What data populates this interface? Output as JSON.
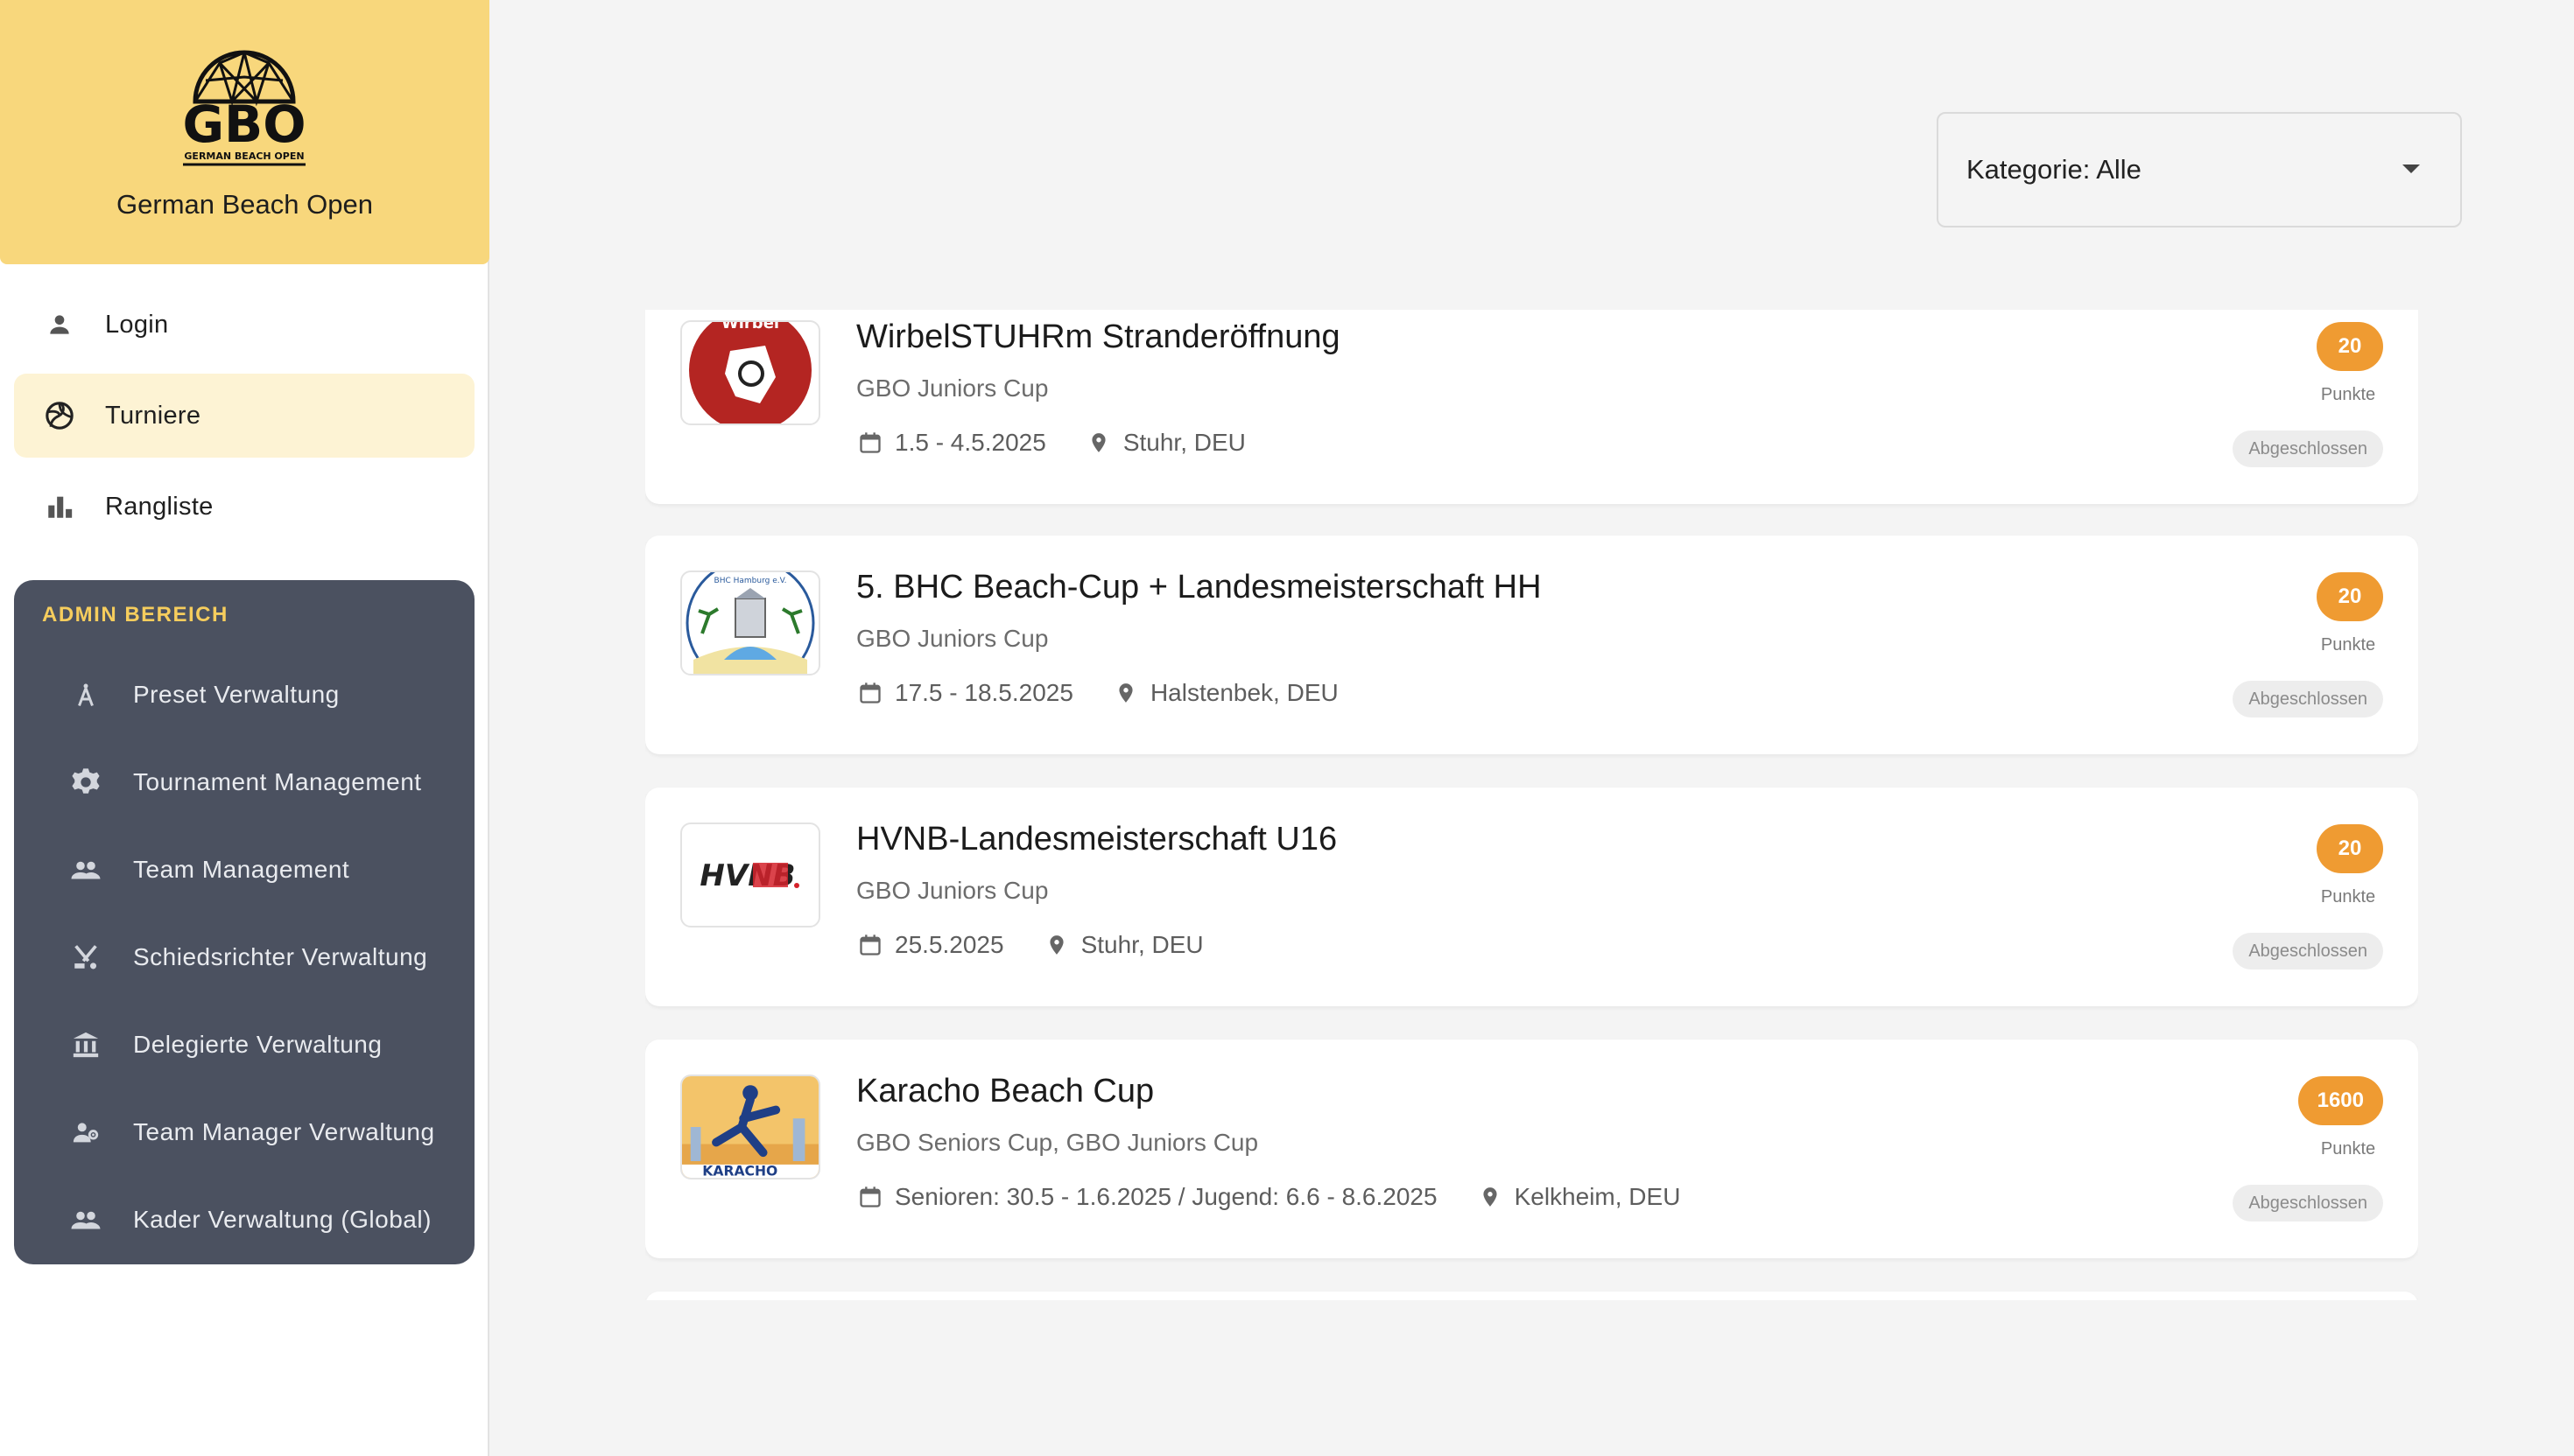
{
  "brand": {
    "name": "German Beach Open",
    "logo_text": "GBO",
    "logo_subtext": "GERMAN BEACH OPEN"
  },
  "nav": [
    {
      "label": "Login",
      "icon": "person-icon",
      "active": false
    },
    {
      "label": "Turniere",
      "icon": "volleyball-icon",
      "active": true
    },
    {
      "label": "Rangliste",
      "icon": "bar-chart-icon",
      "active": false
    }
  ],
  "admin": {
    "title": "ADMIN BEREICH",
    "items": [
      {
        "label": "Preset Verwaltung",
        "icon": "compass-icon"
      },
      {
        "label": "Tournament Management",
        "icon": "gear-icon"
      },
      {
        "label": "Team Management",
        "icon": "people-icon"
      },
      {
        "label": "Schiedsrichter Verwaltung",
        "icon": "sports-icon"
      },
      {
        "label": "Delegierte Verwaltung",
        "icon": "institution-icon"
      },
      {
        "label": "Team Manager Verwaltung",
        "icon": "manage-people-icon"
      },
      {
        "label": "Kader Verwaltung (Global)",
        "icon": "people-icon"
      }
    ]
  },
  "filter": {
    "label": "Kategorie: Alle"
  },
  "tournaments": [
    {
      "title": "WirbelSTUHRm Stranderöffnung",
      "category": "GBO Juniors Cup",
      "dates": "1.5 - 4.5.2025",
      "location": "Stuhr, DEU",
      "points": "20",
      "points_label": "Punkte",
      "status": "Abgeschlossen",
      "logo_text": "Wirbel"
    },
    {
      "title": "5. BHC Beach-Cup + Landesmeisterschaft HH",
      "category": "GBO Juniors Cup",
      "dates": "17.5 - 18.5.2025",
      "location": "Halstenbek, DEU",
      "points": "20",
      "points_label": "Punkte",
      "status": "Abgeschlossen",
      "logo_text": "BHC Hamburg e.V."
    },
    {
      "title": "HVNB-Landesmeisterschaft U16",
      "category": "GBO Juniors Cup",
      "dates": "25.5.2025",
      "location": "Stuhr, DEU",
      "points": "20",
      "points_label": "Punkte",
      "status": "Abgeschlossen",
      "logo_text": "HVNB"
    },
    {
      "title": "Karacho Beach Cup",
      "category": "GBO Seniors Cup, GBO Juniors Cup",
      "dates": "Senioren: 30.5 - 1.6.2025 / Jugend: 6.6 - 8.6.2025",
      "location": "Kelkheim, DEU",
      "points": "1600",
      "points_label": "Punkte",
      "status": "Abgeschlossen",
      "logo_text": "KARACHO"
    }
  ],
  "colors": {
    "brand_yellow": "#f8d77c",
    "admin_bg": "#4b5160",
    "admin_title": "#f6cd5d",
    "points_orange": "#ef9b32",
    "active_nav": "#fdf3d4"
  }
}
